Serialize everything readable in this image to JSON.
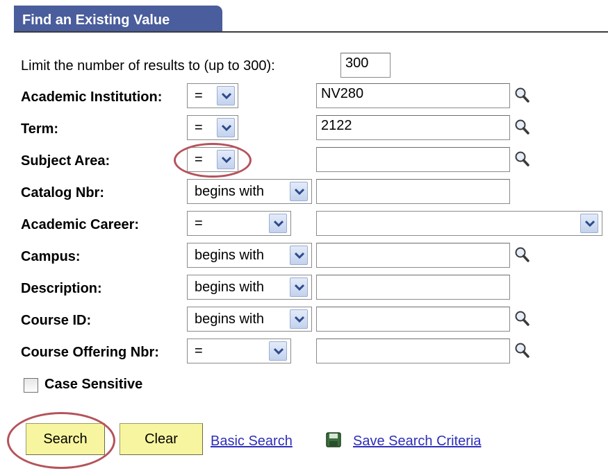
{
  "tab": {
    "title": "Find an Existing Value"
  },
  "limit": {
    "label": "Limit the number of results to (up to 300):",
    "value": "300"
  },
  "fields": [
    {
      "label": "Academic Institution:",
      "operator": "=",
      "value": "NV280"
    },
    {
      "label": "Term:",
      "operator": "=",
      "value": "2122"
    },
    {
      "label": "Subject Area:",
      "operator": "=",
      "value": ""
    },
    {
      "label": "Catalog Nbr:",
      "operator": "begins with",
      "value": ""
    },
    {
      "label": "Academic Career:",
      "operator": "=",
      "value": ""
    },
    {
      "label": "Campus:",
      "operator": "begins with",
      "value": ""
    },
    {
      "label": "Description:",
      "operator": "begins with",
      "value": ""
    },
    {
      "label": "Course ID:",
      "operator": "begins with",
      "value": ""
    },
    {
      "label": "Course Offering Nbr:",
      "operator": "=",
      "value": ""
    }
  ],
  "case_sensitive": {
    "label": "Case Sensitive",
    "checked": false
  },
  "buttons": {
    "search": "Search",
    "clear": "Clear"
  },
  "links": {
    "basic_search": "Basic Search",
    "save_criteria": "Save Search Criteria"
  },
  "colors": {
    "tab": "#4a5d9c",
    "button": "#f7f59f",
    "link": "#2e2eb8",
    "highlight": "#b5535b"
  },
  "icons": {
    "lookup": "magnifier-icon",
    "dropdown": "chevron-down-icon",
    "save": "floppy-disk-icon"
  }
}
